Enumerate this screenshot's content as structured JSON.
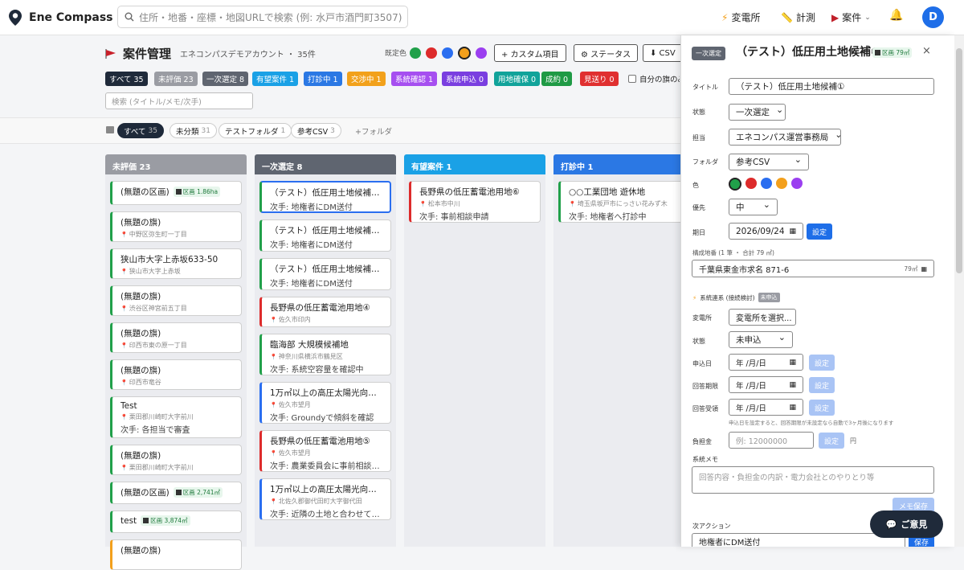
{
  "app": {
    "name": "Ene Compass",
    "search_placeholder": "住所・地番・座標・地図URLで検索 (例: 水戸市酒門町3507)",
    "avatar": "D"
  },
  "nav": {
    "substation": "変電所",
    "measure": "計測",
    "cases": "案件"
  },
  "project": {
    "title": "案件管理",
    "account": "エネコンパスデモアカウント ・ 35件",
    "default_color_label": "既定色",
    "colors": [
      "#21a04a",
      "#dd2b2b",
      "#2a6ef0",
      "#f3a01c",
      "#9b3ff0"
    ],
    "btn_custom": "+ カスタム項目",
    "btn_status": "⚙ ステータス",
    "btn_csv": "⬇ CSV"
  },
  "filters": [
    {
      "label": "すべて 35",
      "color": "#1f2a3a"
    },
    {
      "label": "未評価 23",
      "color": "#9a9ca3"
    },
    {
      "label": "一次選定 8",
      "color": "#5f6570"
    },
    {
      "label": "有望案件 1",
      "color": "#1aa1e6"
    },
    {
      "label": "打診中 1",
      "color": "#2b78e4"
    },
    {
      "label": "交渉中 1",
      "color": "#f2a11b"
    },
    {
      "label": "系統確認 1",
      "color": "#a64ff0"
    },
    {
      "label": "系統申込 0",
      "color": "#7a3fe0"
    },
    {
      "label": "用地確保 0",
      "color": "#11a39a"
    },
    {
      "label": "成約 0",
      "color": "#1f9a45"
    },
    {
      "label": "見送り 0",
      "color": "#e03030"
    }
  ],
  "own_only": "自分の旗のみ",
  "search_filter_placeholder": "検索 (タイトル/メモ/次手)",
  "folders": [
    {
      "label": "すべて",
      "count": "35"
    },
    {
      "label": "未分類",
      "count": "31"
    },
    {
      "label": "テストフォルダ",
      "count": "1"
    },
    {
      "label": "参考CSV",
      "count": "3"
    },
    {
      "label": "+フォルダ",
      "count": ""
    }
  ],
  "columns": [
    {
      "title": "未評価 23",
      "color": "#9a9ca3",
      "cards": [
        {
          "title": "(無題の区画)",
          "loc": "",
          "next": "",
          "area": "区画 1.86ha",
          "accent": "#21a04a",
          "h": 30
        },
        {
          "title": "(無題の旗)",
          "loc": "中野区弥生町一丁目",
          "next": "",
          "area": "",
          "accent": "#21a04a",
          "h": 38
        },
        {
          "title": "狭山市大字上赤坂633-50",
          "loc": "狭山市大字上赤坂",
          "next": "",
          "area": "",
          "accent": "#21a04a",
          "h": 38
        },
        {
          "title": "(無題の旗)",
          "loc": "渋谷区神宮前五丁目",
          "next": "",
          "area": "",
          "accent": "#21a04a",
          "h": 38
        },
        {
          "title": "(無題の旗)",
          "loc": "印西市東の原一丁目",
          "next": "",
          "area": "",
          "accent": "#21a04a",
          "h": 38
        },
        {
          "title": "(無題の旗)",
          "loc": "印西市竜谷",
          "next": "",
          "area": "",
          "accent": "#21a04a",
          "h": 38
        },
        {
          "title": "Test",
          "loc": "栗田郡川崎町大字前川",
          "next": "次手: 各担当で審査",
          "area": "",
          "accent": "#21a04a",
          "h": 52
        },
        {
          "title": "(無題の旗)",
          "loc": "栗田郡川崎町大字前川",
          "next": "",
          "area": "",
          "accent": "#21a04a",
          "h": 38
        },
        {
          "title": "(無題の区画)",
          "loc": "",
          "next": "",
          "area": "区画 2,741㎡",
          "accent": "#21a04a",
          "h": 28
        },
        {
          "title": "test",
          "loc": "",
          "next": "",
          "area": "区画 3,874㎡",
          "accent": "#21a04a",
          "h": 28
        },
        {
          "title": "(無題の旗)",
          "loc": "",
          "next": "",
          "area": "",
          "accent": "#f3a01c",
          "h": 38
        }
      ]
    },
    {
      "title": "一次選定 8",
      "color": "#5f6570",
      "cards": [
        {
          "title": "（テスト）低圧用土地候補①...",
          "loc": "",
          "next": "次手: 地権者にDM送付",
          "area": "",
          "accent": "#21a04a",
          "h": 40,
          "selected": true
        },
        {
          "title": "（テスト）低圧用土地候補②...",
          "loc": "",
          "next": "次手: 地権者にDM送付",
          "area": "",
          "accent": "#21a04a",
          "h": 40
        },
        {
          "title": "（テスト）低圧用土地候補③...",
          "loc": "",
          "next": "次手: 地権者にDM送付",
          "area": "",
          "accent": "#21a04a",
          "h": 40
        },
        {
          "title": "長野県の低圧蓄電池用地④",
          "loc": "佐久市印内",
          "next": "",
          "area": "",
          "accent": "#dd2b2b",
          "h": 38
        },
        {
          "title": "臨海部 大規模候補地",
          "loc": "神奈川県横浜市鶴見区",
          "next": "次手: 系統空容量を確認中",
          "area": "",
          "accent": "#21a04a",
          "h": 52
        },
        {
          "title": "1万㎡以上の高圧太陽光向けの...",
          "loc": "佐久市望月",
          "next": "次手: Groundyで傾斜を確認",
          "area": "",
          "accent": "#2a6ef0",
          "h": 52
        },
        {
          "title": "長野県の低圧蓄電池用地⑤",
          "loc": "佐久市望月",
          "next": "次手: 農業委員会に事前相談中...",
          "area": "",
          "accent": "#dd2b2b",
          "h": 52
        },
        {
          "title": "1万㎡以上の高圧太陽光向けの...",
          "loc": "北佐久郡御代田町大字御代田",
          "next": "次手: 近隣の土地と合わせて10...",
          "area": "",
          "accent": "#2a6ef0",
          "h": 52
        }
      ]
    },
    {
      "title": "有望案件 1",
      "color": "#1aa1e6",
      "cards": [
        {
          "title": "長野県の低圧蓄電池用地⑥",
          "loc": "松本市中川",
          "next": "次手: 事前相談申請",
          "area": "",
          "accent": "#dd2b2b",
          "h": 52
        }
      ]
    },
    {
      "title": "打診中 1",
      "color": "#2b78e4",
      "cards": [
        {
          "title": "○○工業団地 遊休地",
          "loc": "埼玉県坂戸市にっさい花みず木",
          "next": "次手: 地権者へ打診中",
          "area": "",
          "accent": "#21a04a",
          "h": 52
        }
      ]
    }
  ],
  "panel": {
    "status_tag": "一次選定",
    "title": "（テスト）低圧用土地候補①",
    "area_badge": "区画 79㎡",
    "close": "×",
    "f_title_label": "タイトル",
    "f_title_value": "（テスト）低圧用土地候補①",
    "f_state_label": "状態",
    "f_state_value": "一次選定",
    "f_owner_label": "担当",
    "f_owner_value": "エネコンパス運営事務局",
    "f_folder_label": "フォルダ",
    "f_folder_value": "参考CSV",
    "f_color_label": "色",
    "f_priority_label": "優先",
    "f_priority_value": "中",
    "f_due_label": "期日",
    "f_due_value": "2026/09/24",
    "set": "設定",
    "parcels_label": "構成地番 (1 筆 ・ 合計 79 ㎡)",
    "parcel": "千葉県東金市求名 871-6",
    "parcel_area": "79㎡",
    "grid_section": "系統連系 (接続検討)",
    "grid_badge": "未申込",
    "sub_label": "変電所",
    "sub_value": "変電所を選択...",
    "gstate_label": "状態",
    "gstate_value": "未申込",
    "apply_label": "申込日",
    "due2_label": "回答期限",
    "recv_label": "回答受領",
    "date_ph": "年 /月/日",
    "hint": "申込日を設定すると、回答期限が未設定なら自動で3ヶ月後になります",
    "cost_label": "負担金",
    "cost_ph": "例: 12000000",
    "yen": "円",
    "memo_label": "系統メモ",
    "memo_ph": "回答内容・負担金の内訳・電力会社とのやりとり等",
    "memo_save": "メモ保存",
    "next_label": "次アクション",
    "next_value": "地権者にDM送付",
    "save": "保存"
  },
  "feedback": "ご意見"
}
